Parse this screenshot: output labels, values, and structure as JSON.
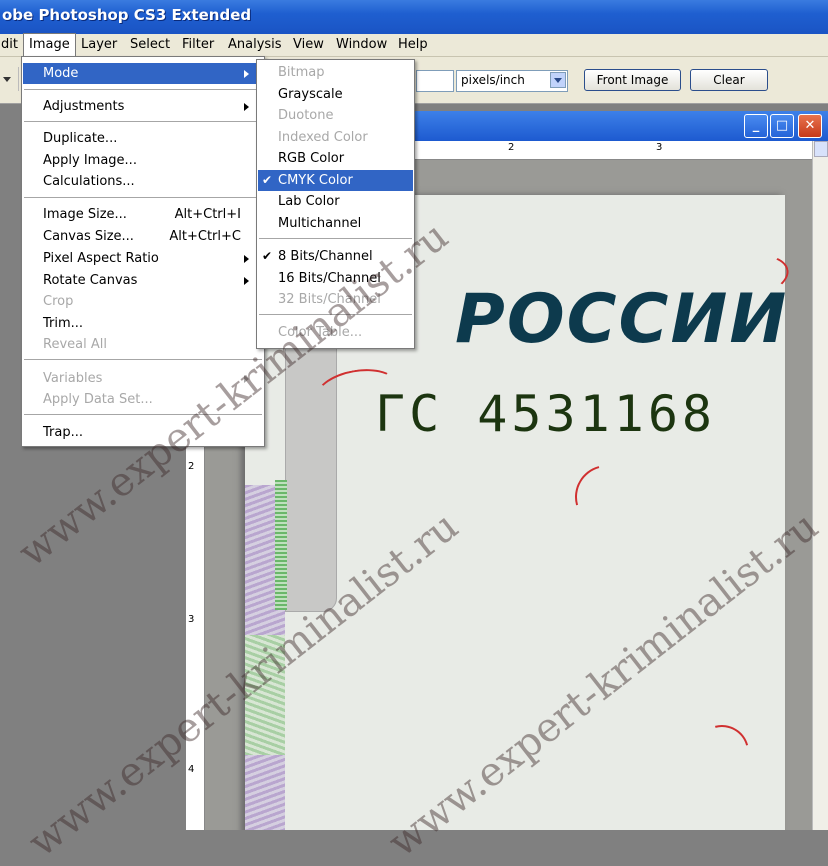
{
  "title": "obe Photoshop CS3 Extended",
  "menubar": [
    "dit",
    "Image",
    "Layer",
    "Select",
    "Filter",
    "Analysis",
    "View",
    "Window",
    "Help"
  ],
  "options": {
    "resolution_value": "",
    "units": "pixels/inch",
    "front_image": "Front Image",
    "clear": "Clear"
  },
  "ruler": {
    "h": [
      "2",
      "3"
    ],
    "v": [
      "2",
      "3",
      "4"
    ]
  },
  "image_menu": [
    {
      "label": "Mode",
      "shortcut": "",
      "submenu": true,
      "enabled": true,
      "highlight": true
    },
    {
      "label": "Adjustments",
      "shortcut": "",
      "submenu": true,
      "enabled": true
    },
    {
      "label": "Duplicate...",
      "shortcut": "",
      "submenu": false,
      "enabled": true
    },
    {
      "label": "Apply Image...",
      "shortcut": "",
      "submenu": false,
      "enabled": true
    },
    {
      "label": "Calculations...",
      "shortcut": "",
      "submenu": false,
      "enabled": true
    },
    {
      "label": "Image Size...",
      "shortcut": "Alt+Ctrl+I",
      "submenu": false,
      "enabled": true
    },
    {
      "label": "Canvas Size...",
      "shortcut": "Alt+Ctrl+C",
      "submenu": false,
      "enabled": true
    },
    {
      "label": "Pixel Aspect Ratio",
      "shortcut": "",
      "submenu": true,
      "enabled": true
    },
    {
      "label": "Rotate Canvas",
      "shortcut": "",
      "submenu": true,
      "enabled": true
    },
    {
      "label": "Crop",
      "shortcut": "",
      "submenu": false,
      "enabled": false
    },
    {
      "label": "Trim...",
      "shortcut": "",
      "submenu": false,
      "enabled": true
    },
    {
      "label": "Reveal All",
      "shortcut": "",
      "submenu": false,
      "enabled": false
    },
    {
      "label": "Variables",
      "shortcut": "",
      "submenu": true,
      "enabled": false
    },
    {
      "label": "Apply Data Set...",
      "shortcut": "",
      "submenu": false,
      "enabled": false
    },
    {
      "label": "Trap...",
      "shortcut": "",
      "submenu": false,
      "enabled": true
    }
  ],
  "mode_menu": [
    {
      "label": "Bitmap",
      "enabled": false,
      "checked": false
    },
    {
      "label": "Grayscale",
      "enabled": true,
      "checked": false
    },
    {
      "label": "Duotone",
      "enabled": false,
      "checked": false
    },
    {
      "label": "Indexed Color",
      "enabled": false,
      "checked": false
    },
    {
      "label": "RGB Color",
      "enabled": true,
      "checked": false
    },
    {
      "label": "CMYK Color",
      "enabled": true,
      "checked": true,
      "highlight": true
    },
    {
      "label": "Lab Color",
      "enabled": true,
      "checked": false
    },
    {
      "label": "Multichannel",
      "enabled": true,
      "checked": false
    },
    {
      "label": "8 Bits/Channel",
      "enabled": true,
      "checked": true
    },
    {
      "label": "16 Bits/Channel",
      "enabled": true,
      "checked": false
    },
    {
      "label": "32 Bits/Channel",
      "enabled": false,
      "checked": false
    },
    {
      "label": "Color Table...",
      "enabled": false,
      "checked": false
    }
  ],
  "banknote": {
    "title": "РОССИИ",
    "serial": "ГС 4531168"
  },
  "watermark": "www.expert-kriminalist.ru",
  "colors": {
    "menu_highlight": "#3165c5",
    "titlebar": "#1f5fd0",
    "menubar_bg": "#ece9d8"
  }
}
